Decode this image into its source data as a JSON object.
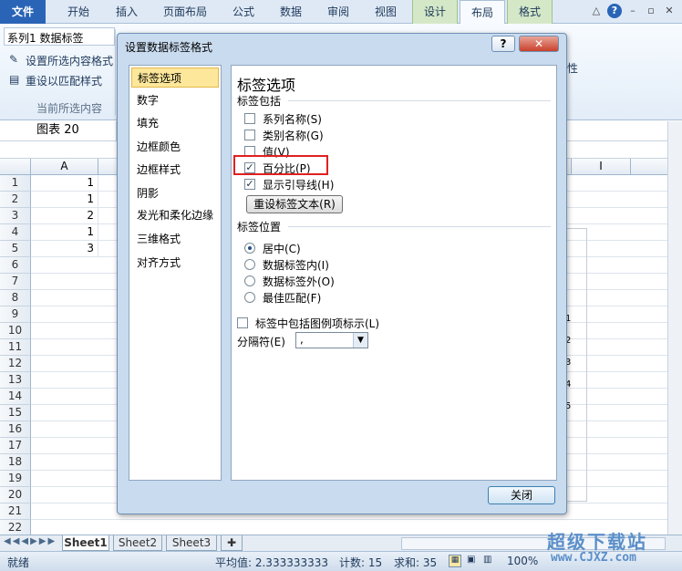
{
  "ribbon": {
    "tabs": [
      "文件",
      "开始",
      "插入",
      "页面布局",
      "公式",
      "数据",
      "审阅",
      "视图",
      "设计",
      "布局",
      "格式"
    ],
    "selection_combo": "系列1 数据标签",
    "format_selection": "设置所选内容格式",
    "reset_style": "重设以匹配样式",
    "group_label": "当前所选内容",
    "right_fragment": "性"
  },
  "formula_bar": {
    "name_box": "图表 20"
  },
  "grid": {
    "col_a": "A",
    "col_i": "I",
    "rows": [
      "1",
      "2",
      "3",
      "4",
      "5",
      "6",
      "7",
      "8",
      "9",
      "10",
      "11",
      "12",
      "13",
      "14",
      "15",
      "16",
      "17",
      "18",
      "19",
      "20",
      "21",
      "22"
    ],
    "col_a_values": [
      "1",
      "1",
      "2",
      "1",
      "3"
    ],
    "chart_fragments": [
      "1",
      "2",
      "3",
      "4",
      "5"
    ]
  },
  "sheets": [
    "Sheet1",
    "Sheet2",
    "Sheet3"
  ],
  "status": {
    "ready": "就绪",
    "average": "平均值: 2.333333333",
    "count": "计数: 15",
    "sum": "求和: 35",
    "zoom": "100%"
  },
  "dialog": {
    "title": "设置数据标签格式",
    "help": "?",
    "close_x": "✕",
    "nav": [
      "标签选项",
      "数字",
      "填充",
      "边框颜色",
      "边框样式",
      "阴影",
      "发光和柔化边缘",
      "三维格式",
      "对齐方式"
    ],
    "panel_title": "标签选项",
    "contains_heading": "标签包括",
    "options": [
      {
        "label": "系列名称(S)",
        "checked": false
      },
      {
        "label": "类别名称(G)",
        "checked": false
      },
      {
        "label": "值(V)",
        "checked": false
      },
      {
        "label": "百分比(P)",
        "checked": true
      },
      {
        "label": "显示引导线(H)",
        "checked": true
      }
    ],
    "reset_text_button": "重设标签文本(R)",
    "position_heading": "标签位置",
    "positions": [
      {
        "label": "居中(C)",
        "selected": true
      },
      {
        "label": "数据标签内(I)",
        "selected": false
      },
      {
        "label": "数据标签外(O)",
        "selected": false
      },
      {
        "label": "最佳匹配(F)",
        "selected": false
      }
    ],
    "legend_key": "标签中包括图例项标示(L)",
    "separator_label": "分隔符(E)",
    "separator_value": ",",
    "close_button": "关闭"
  },
  "watermark": {
    "title": "超级下载站",
    "url": "www.CJXZ.com"
  }
}
